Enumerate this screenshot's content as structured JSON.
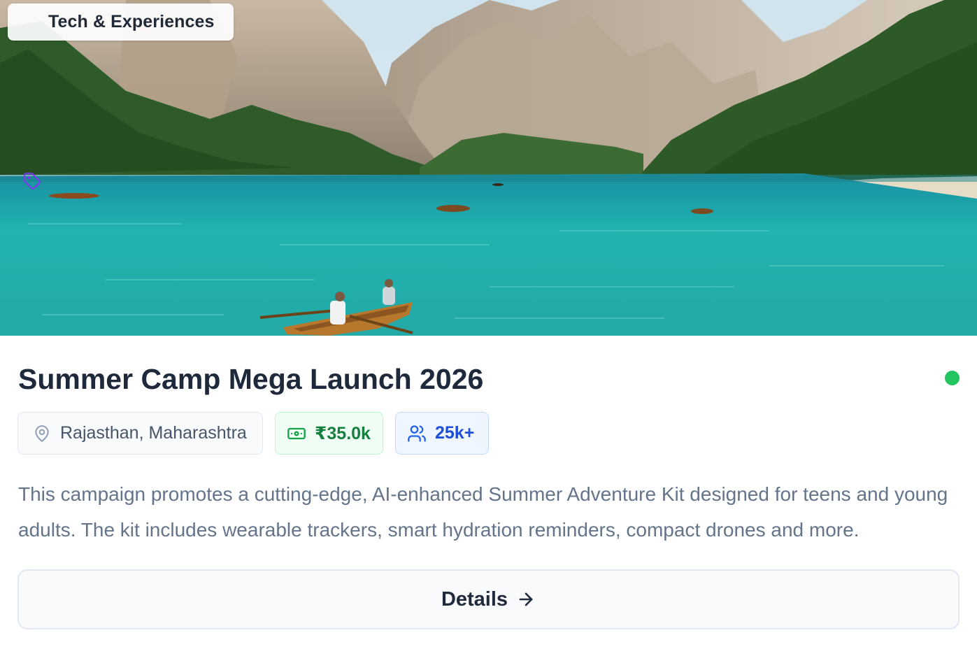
{
  "category": {
    "label": "Tech & Experiences",
    "icon": "tag-icon",
    "color": "#7c3aed"
  },
  "campaign": {
    "title": "Summer Camp Mega Launch 2026",
    "status_color": "#22c55e",
    "location": {
      "icon": "map-pin-icon",
      "text": "Rajasthan, Maharashtra"
    },
    "budget": {
      "icon": "banknote-icon",
      "text": "₹35.0k"
    },
    "reach": {
      "icon": "users-icon",
      "text": "25k+"
    },
    "description": "This campaign promotes a cutting-edge, AI-enhanced Summer Adventure Kit designed for teens and young adults. The kit includes wearable trackers, smart hydration reminders, compact drones and more."
  },
  "actions": {
    "details_label": "Details",
    "details_icon": "arrow-right-icon"
  },
  "colors": {
    "title": "#1e293b",
    "muted": "#64748b",
    "budget": "#15803d",
    "reach": "#1d4ed8"
  }
}
